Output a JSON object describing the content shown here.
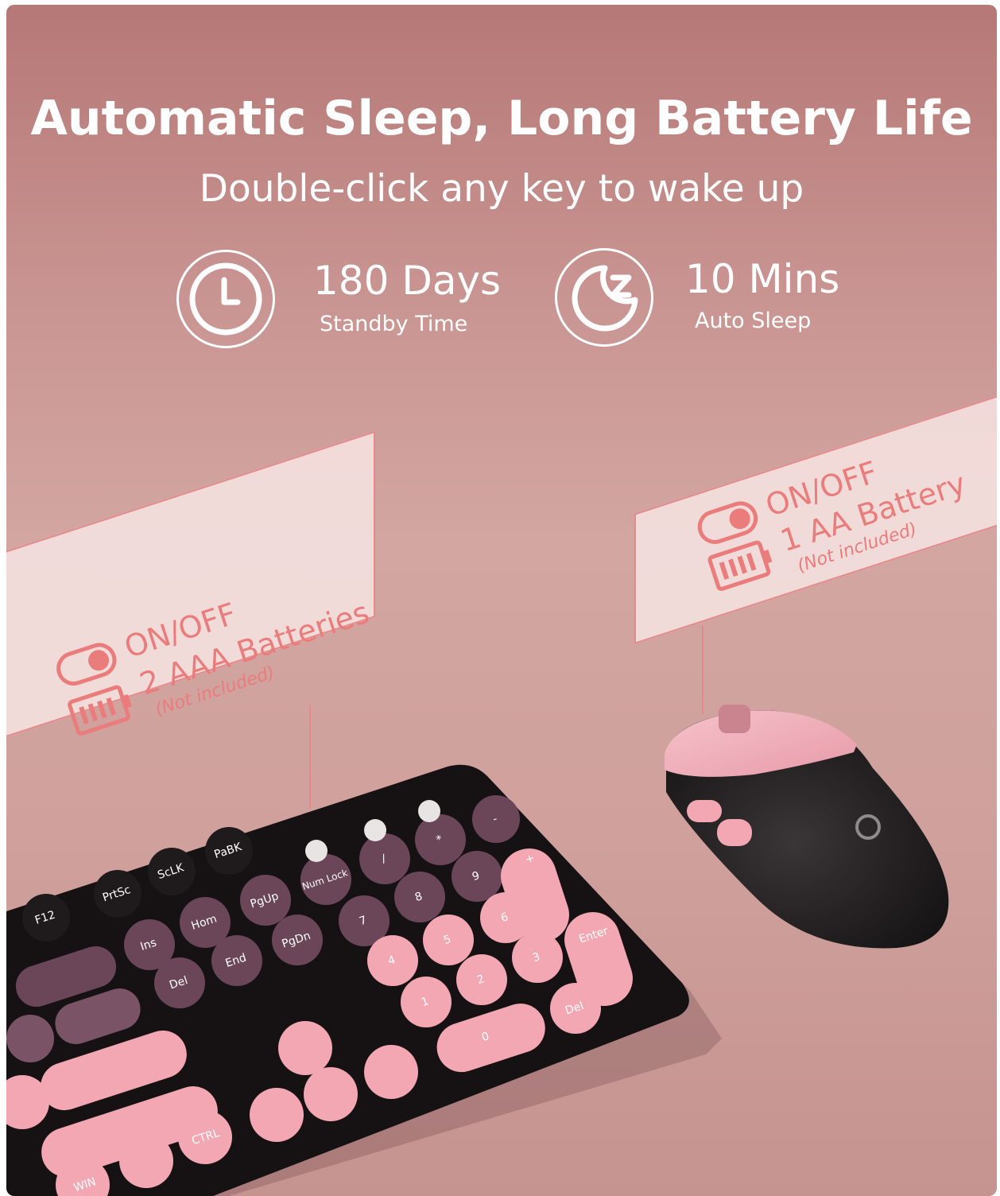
{
  "headline": "Automatic Sleep, Long Battery Life",
  "subheadline": "Double-click any key to wake up",
  "stats": [
    {
      "icon": "clock-icon",
      "value": "180 Days",
      "caption": "Standby Time"
    },
    {
      "icon": "moon-sleep-icon",
      "value": "10 Mins",
      "caption": "Auto Sleep"
    }
  ],
  "keyboard_label": {
    "power": "ON/OFF",
    "battery": "2 AAA Batteries",
    "note": "(Not included)",
    "icons": [
      "toggle-switch-icon",
      "battery-icon"
    ]
  },
  "mouse_label": {
    "power": "ON/OFF",
    "battery": "1 AA Battery",
    "note": "(Not included)",
    "icons": [
      "toggle-switch-icon",
      "battery-icon"
    ]
  },
  "keycaps": [
    "F12",
    "PrtSc",
    "ScLK",
    "PaBK",
    "Ins",
    "Hom",
    "PgUp",
    "Num Lock",
    "/",
    "*",
    "-",
    "Del",
    "End",
    "PgDn",
    "7",
    "8",
    "9",
    "+",
    "4",
    "5",
    "6",
    "1",
    "2",
    "3",
    "Enter",
    "0",
    "Del",
    "CTRL",
    "WIN"
  ],
  "colors": {
    "background_top": "#b67876",
    "background_bottom": "#c59390",
    "accent_text": "#ea7c7c",
    "keycap_pink": "#f2a7b2",
    "keycap_plum": "#6a4658",
    "keyboard_body": "#161214"
  }
}
